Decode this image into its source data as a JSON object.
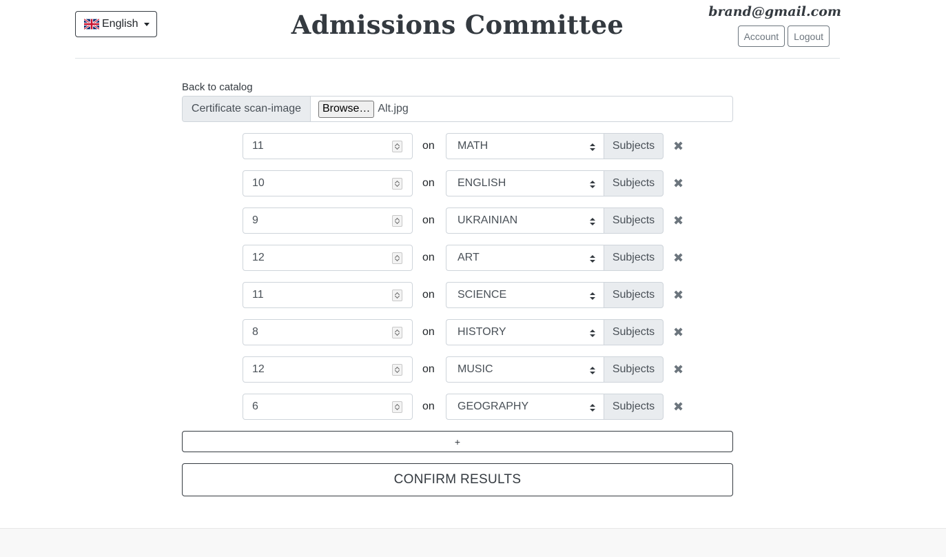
{
  "header": {
    "language_label": "English",
    "title": "Admissions Committee",
    "email": "brand@gmail.com",
    "account_label": "Account",
    "logout_label": "Logout"
  },
  "form": {
    "back_link": "Back to catalog",
    "file_label": "Certificate scan-image",
    "browse_label": "Browse…",
    "file_name": "Alt.jpg",
    "on_label": "on",
    "subjects_label": "Subjects",
    "rows": [
      {
        "score": "11",
        "subject": "MATH"
      },
      {
        "score": "10",
        "subject": "ENGLISH"
      },
      {
        "score": "9",
        "subject": "UKRAINIAN"
      },
      {
        "score": "12",
        "subject": "ART"
      },
      {
        "score": "11",
        "subject": "SCIENCE"
      },
      {
        "score": "8",
        "subject": "HISTORY"
      },
      {
        "score": "12",
        "subject": "MUSIC"
      },
      {
        "score": "6",
        "subject": "GEOGRAPHY"
      }
    ],
    "add_label": "+",
    "confirm_label": "CONFIRM RESULTS"
  },
  "icons": {
    "remove": "close-icon",
    "flag": "uk-flag-icon"
  }
}
